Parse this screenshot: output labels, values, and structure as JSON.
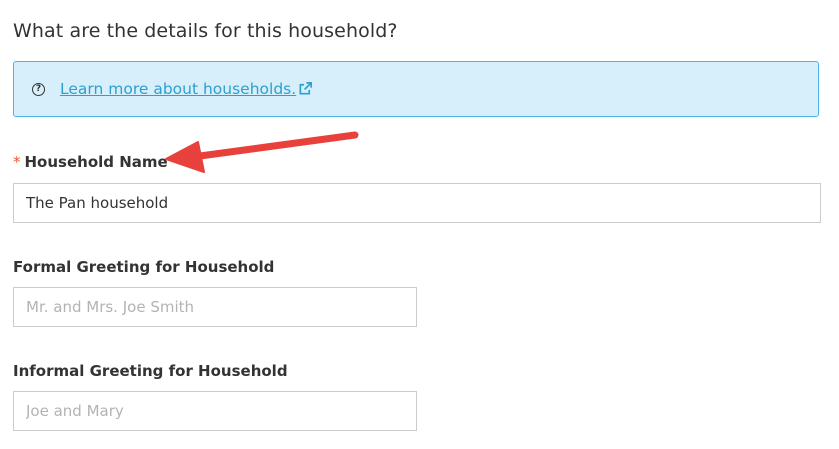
{
  "page": {
    "heading": "What are the details for this household?"
  },
  "info_box": {
    "help_icon_glyph": "?",
    "link_text": "Learn more about households.",
    "link_icon": "external-link-icon",
    "background_color": "#d6effa",
    "border_color": "#4bb3e5",
    "link_color": "#2d9fd0"
  },
  "fields": {
    "household_name": {
      "required_marker": "*",
      "label": "Household Name",
      "value": "The Pan household",
      "placeholder": ""
    },
    "formal_greeting": {
      "label": "Formal Greeting for Household",
      "value": "",
      "placeholder": "Mr. and Mrs. Joe Smith"
    },
    "informal_greeting": {
      "label": "Informal Greeting for Household",
      "value": "",
      "placeholder": "Joe and Mary"
    }
  },
  "annotation": {
    "arrow_color": "#e8413c"
  }
}
